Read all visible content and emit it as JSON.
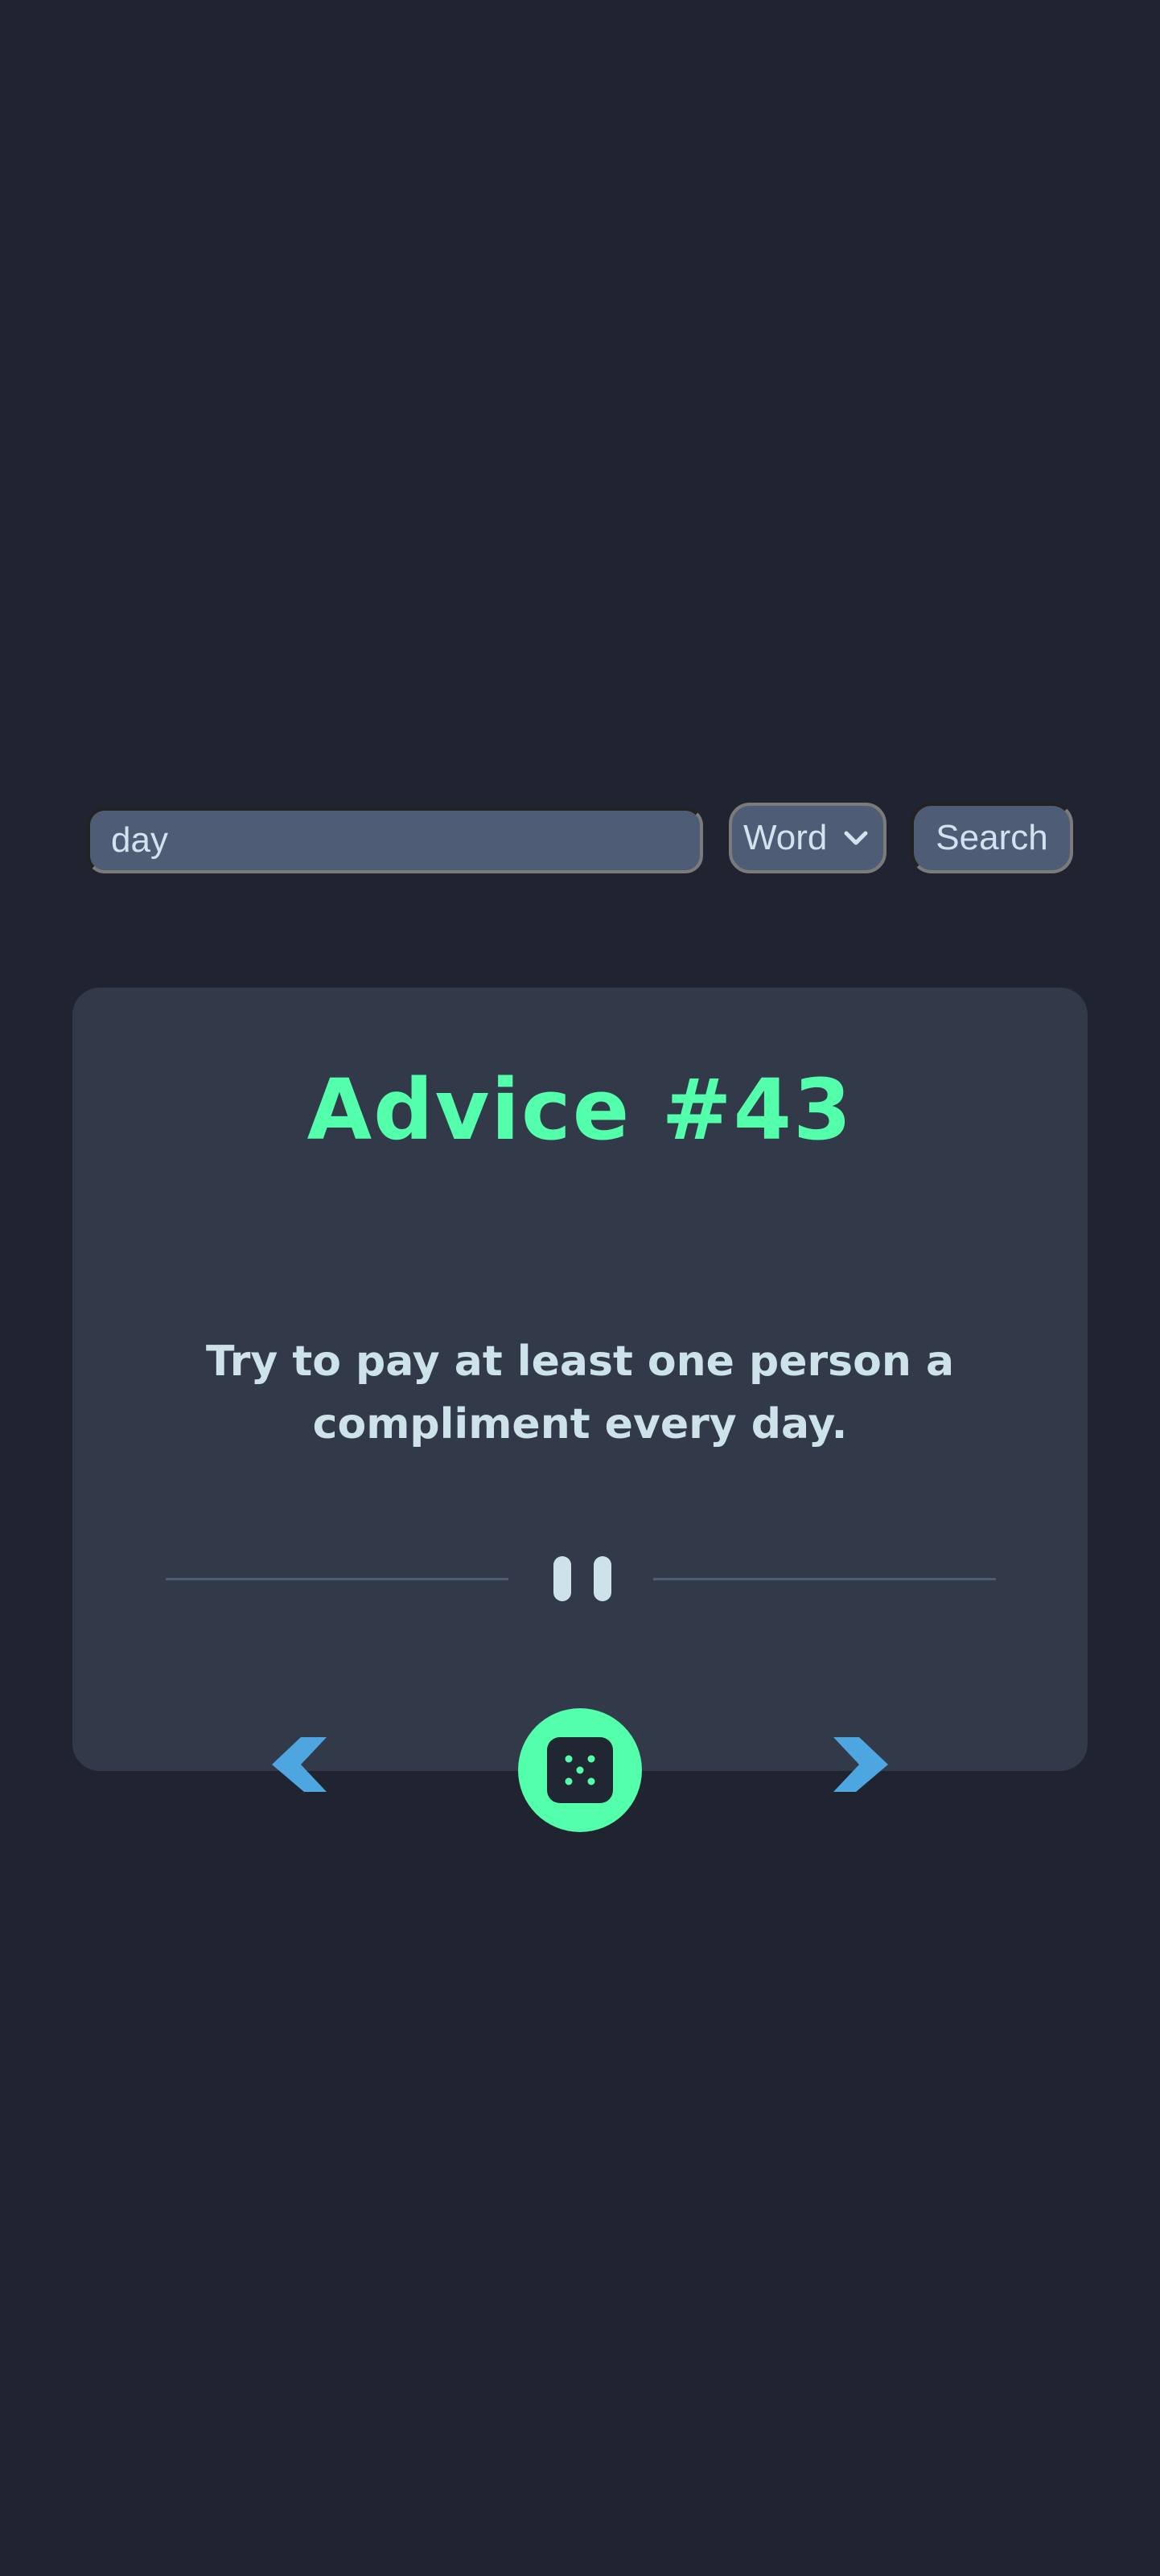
{
  "search": {
    "value": "day",
    "mode_selected": "Word",
    "button_label": "Search"
  },
  "advice": {
    "title": "Advice #43",
    "text": "Try to pay at least one person a compliment every day."
  },
  "colors": {
    "background": "#1f2430",
    "card": "#323a4a",
    "accent_green": "#53ffab",
    "arrow_blue": "#4ea6e0",
    "text_light": "#cee3e9"
  },
  "icons": {
    "prev": "chevron-left-icon",
    "next": "chevron-right-icon",
    "random": "dice-icon",
    "divider": "pause-icon"
  }
}
